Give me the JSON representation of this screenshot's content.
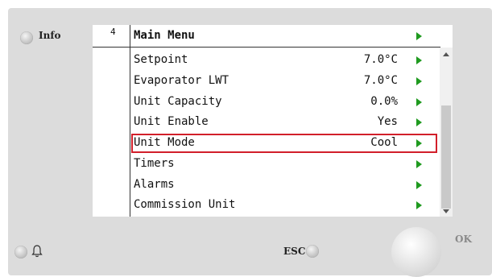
{
  "hardware": {
    "info_label": "Info",
    "esc_label": "ESC",
    "ok_label": "OK",
    "led_color": "#c9c9c9"
  },
  "screen": {
    "menu_number": "4",
    "title": "Main Menu",
    "items": [
      {
        "label": "Setpoint",
        "value": "7.0°C"
      },
      {
        "label": "Evaporator LWT",
        "value": "7.0°C"
      },
      {
        "label": "Unit Capacity",
        "value": "0.0%"
      },
      {
        "label": "Unit Enable",
        "value": "Yes"
      },
      {
        "label": "Unit Mode",
        "value": "Cool"
      },
      {
        "label": "Timers",
        "value": ""
      },
      {
        "label": "Alarms",
        "value": ""
      },
      {
        "label": "Commission Unit",
        "value": ""
      }
    ],
    "selected_item": "Unit Mode",
    "highlight_color": "#d21f2a",
    "arrow_color": "#1f9a1f"
  }
}
